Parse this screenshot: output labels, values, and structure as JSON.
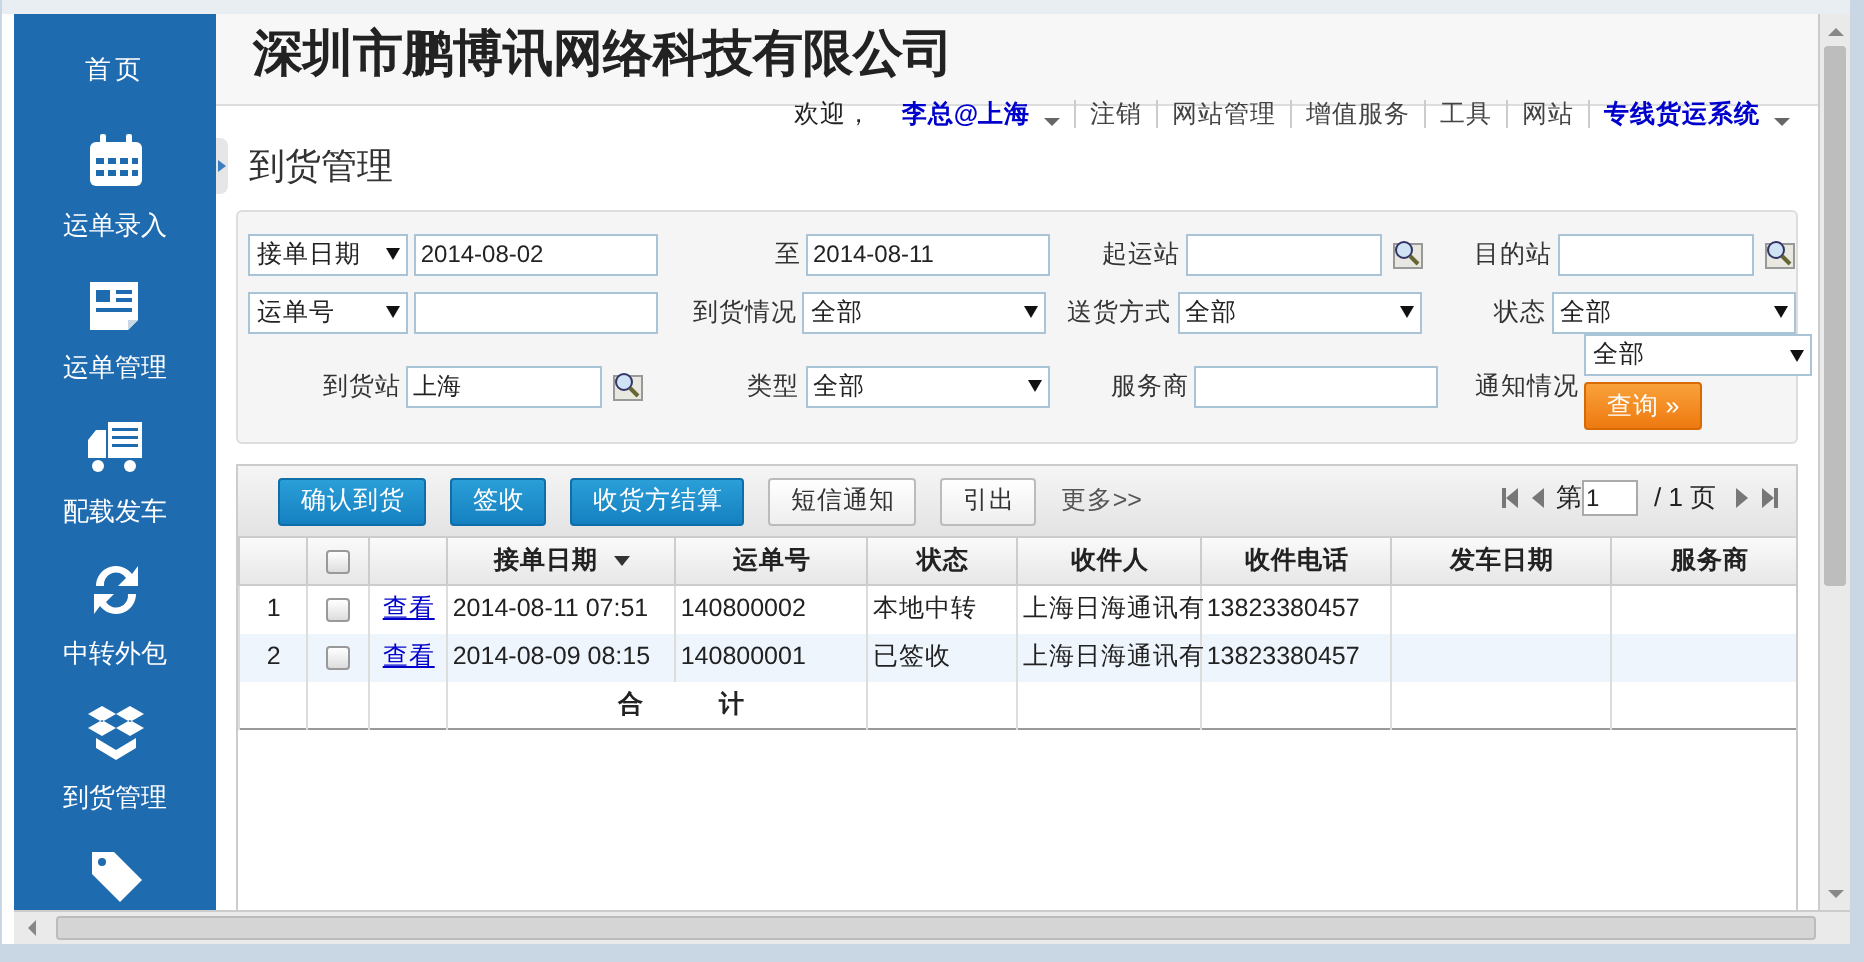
{
  "sidebar": {
    "items": [
      {
        "label": "首页",
        "kind": "home"
      },
      {
        "label": "运单录入",
        "kind": "calendar"
      },
      {
        "label": "运单管理",
        "kind": "document"
      },
      {
        "label": "配载发车",
        "kind": "truck"
      },
      {
        "label": "中转外包",
        "kind": "refresh"
      },
      {
        "label": "到货管理",
        "kind": "box"
      },
      {
        "kind": "tag"
      }
    ]
  },
  "header": {
    "company": "深圳市鹏博讯网络科技有限公司",
    "welcome": "欢迎，",
    "user": "李总@上海",
    "links": [
      {
        "label": "注销",
        "kind": "link"
      },
      {
        "label": "网站管理",
        "kind": "link"
      },
      {
        "label": "增值服务",
        "kind": "link"
      },
      {
        "label": "工具",
        "kind": "link"
      },
      {
        "label": "网站",
        "kind": "link"
      },
      {
        "label": "专线货运系统",
        "kind": "menu"
      }
    ]
  },
  "page_title": "到货管理",
  "filters": [
    [
      {
        "kind": "select",
        "value": "接单日期"
      },
      {
        "kind": "input",
        "value": "2014-08-02"
      },
      {
        "kind": "label",
        "text": "至"
      },
      {
        "kind": "input",
        "value": "2014-08-11"
      },
      {
        "kind": "label",
        "text": "起运站"
      },
      {
        "kind": "lookup"
      },
      {
        "kind": "label",
        "text": "目的站"
      },
      {
        "kind": "lookup"
      }
    ],
    [
      {
        "kind": "select",
        "value": "运单号"
      },
      {
        "kind": "input"
      },
      {
        "kind": "label",
        "text": "到货情况"
      },
      {
        "kind": "select",
        "value": "全部"
      },
      {
        "kind": "label",
        "text": "送货方式"
      },
      {
        "kind": "select",
        "value": "全部"
      },
      {
        "kind": "label",
        "text": "状态"
      },
      {
        "kind": "select",
        "value": "全部"
      }
    ],
    [
      {
        "kind": "label",
        "text": "到货站"
      },
      {
        "kind": "lookup",
        "value": "上海"
      },
      {
        "kind": "label",
        "text": "类型"
      },
      {
        "kind": "select",
        "value": "全部"
      },
      {
        "kind": "label",
        "text": "服务商"
      },
      {
        "kind": "input"
      },
      {
        "kind": "label",
        "text": "通知情况"
      },
      {
        "kind": "select_button",
        "value": "全部",
        "button": "查询 »"
      }
    ]
  ],
  "toolbar": [
    {
      "label": "确认到货",
      "kind": "primary"
    },
    {
      "label": "签收",
      "kind": "primary"
    },
    {
      "label": "收货方结算",
      "kind": "primary"
    },
    {
      "label": "短信通知",
      "kind": "plain"
    },
    {
      "label": "引出",
      "kind": "plain"
    },
    {
      "label": "更多>>",
      "kind": "link"
    }
  ],
  "pager": {
    "prefix": "第",
    "page": "1",
    "suffix": "/ 1 页"
  },
  "table": {
    "all_checked": false,
    "columns": [
      "",
      "",
      "",
      "接单日期",
      "运单号",
      "状态",
      "收件人",
      "收件电话",
      "发车日期",
      "服务商"
    ],
    "rows": [
      {
        "checked": false,
        "cells": [
          "1",
          "",
          "查看",
          "2014-08-11 07:51",
          "140800002",
          "本地中转",
          "上海日海通讯有",
          "13823380457",
          "",
          ""
        ]
      },
      {
        "checked": false,
        "cells": [
          "2",
          "",
          "查看",
          "2014-08-09 08:15",
          "140800001",
          "已签收",
          "上海日海通讯有",
          "13823380457",
          "",
          ""
        ]
      }
    ],
    "total": "合 计"
  }
}
